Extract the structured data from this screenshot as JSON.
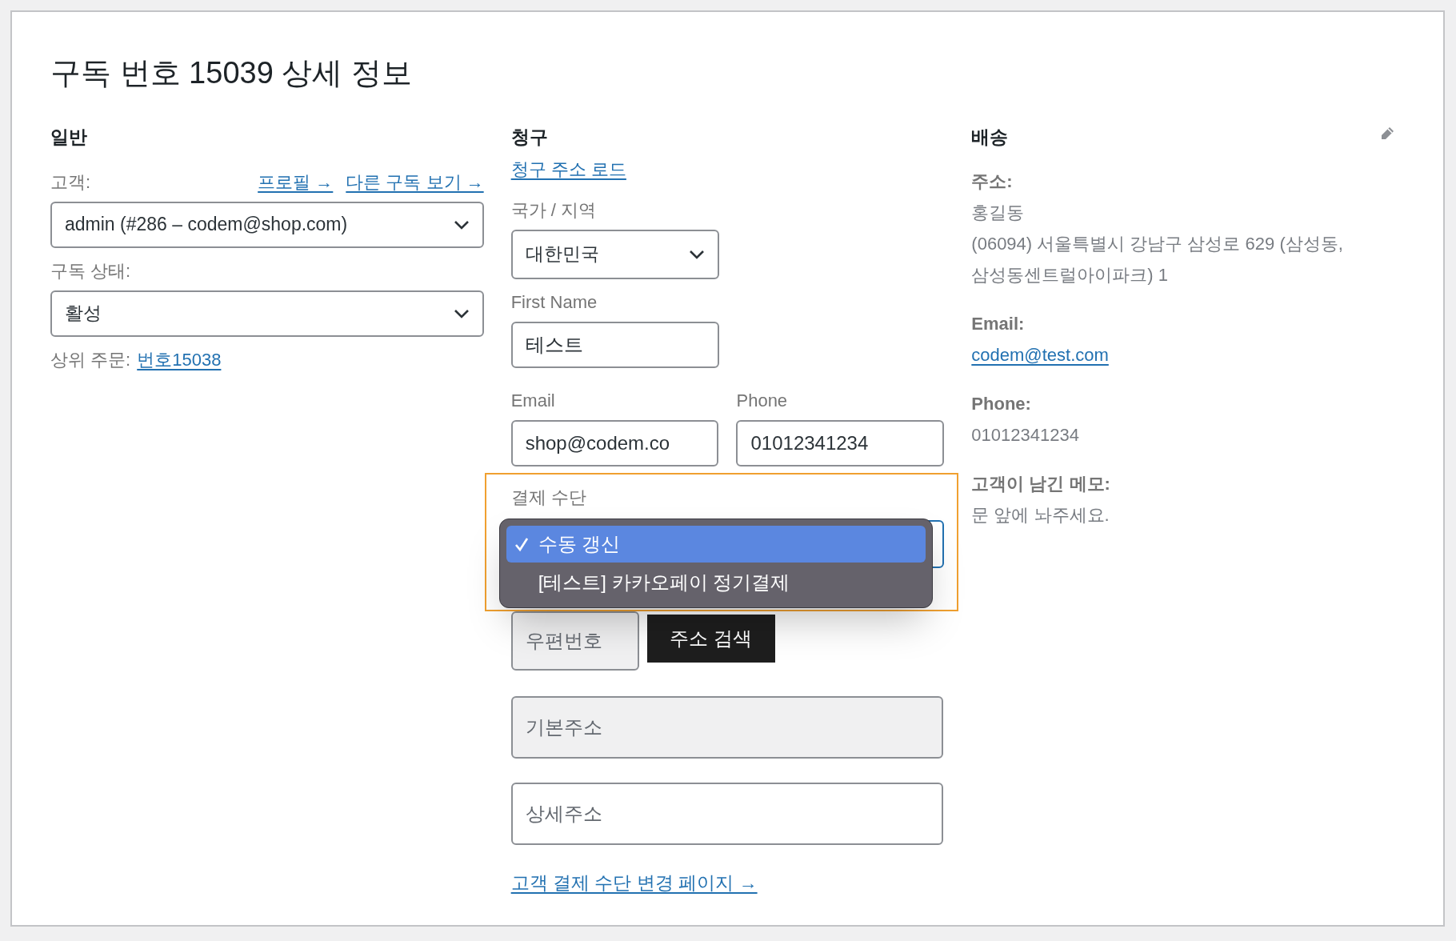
{
  "title": "구독 번호 15039 상세 정보",
  "general": {
    "heading": "일반",
    "customer_label": "고객:",
    "links": [
      "프로필 →",
      "다른 구독 보기 →"
    ],
    "customer_select": {
      "value": "admin (#286 – codem@shop.com)"
    },
    "status_label": "구독 상태:",
    "status_select": {
      "value": "활성"
    },
    "parent_label": "상위 주문:",
    "parent_link": "번호15038"
  },
  "billing": {
    "heading": "청구",
    "load_link": "청구 주소 로드",
    "country": {
      "label": "국가 / 지역",
      "value": "대한민국"
    },
    "first_name": {
      "label": "First Name",
      "value": "테스트"
    },
    "email": {
      "label": "Email",
      "value": "shop@codem.co"
    },
    "phone": {
      "label": "Phone",
      "value": "01012341234"
    },
    "payment": {
      "label": "결제 수단",
      "highlighted": true,
      "expanded": true,
      "options": [
        {
          "label": "수동 갱신",
          "selected": true
        },
        {
          "label": "[테스트] 카카오페이 정기결제",
          "selected": false
        }
      ]
    },
    "postcode": {
      "placeholder": "우편번호",
      "readonly": true
    },
    "search_button": "주소 검색",
    "address_1": {
      "placeholder": "기본주소",
      "readonly": true
    },
    "address_2": {
      "placeholder": "상세주소",
      "readonly": false
    },
    "change_link": "고객 결제 수단 변경 페이지 →"
  },
  "shipping": {
    "heading": "배송",
    "fields": [
      {
        "kind": "text",
        "label": "주소:",
        "lines": [
          "홍길동",
          "(06094) 서울특별시 강남구 삼성로 629 (삼성동,",
          "삼성동센트럴아이파크) 1"
        ]
      },
      {
        "kind": "link",
        "label": "Email:",
        "lines": [
          "codem@test.com"
        ]
      },
      {
        "kind": "text",
        "label": "Phone:",
        "lines": [
          "01012341234"
        ]
      },
      {
        "kind": "text",
        "label": "고객이 남긴 메모:",
        "lines": [
          "문 앞에 놔주세요."
        ]
      }
    ]
  }
}
